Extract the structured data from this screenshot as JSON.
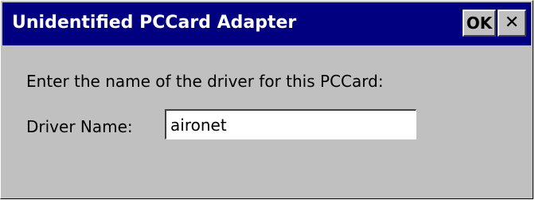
{
  "dialog": {
    "title": "Unidentified PCCard Adapter",
    "ok_label": "OK",
    "close_glyph": "✕",
    "prompt": "Enter the name of the driver for this PCCard:",
    "driver_label": "Driver Name:",
    "driver_value": "aironet"
  },
  "icons": {
    "close": "close-icon"
  },
  "colors": {
    "titlebar": "#000080",
    "face": "#c0c0c0",
    "title_text": "#ffffff"
  }
}
